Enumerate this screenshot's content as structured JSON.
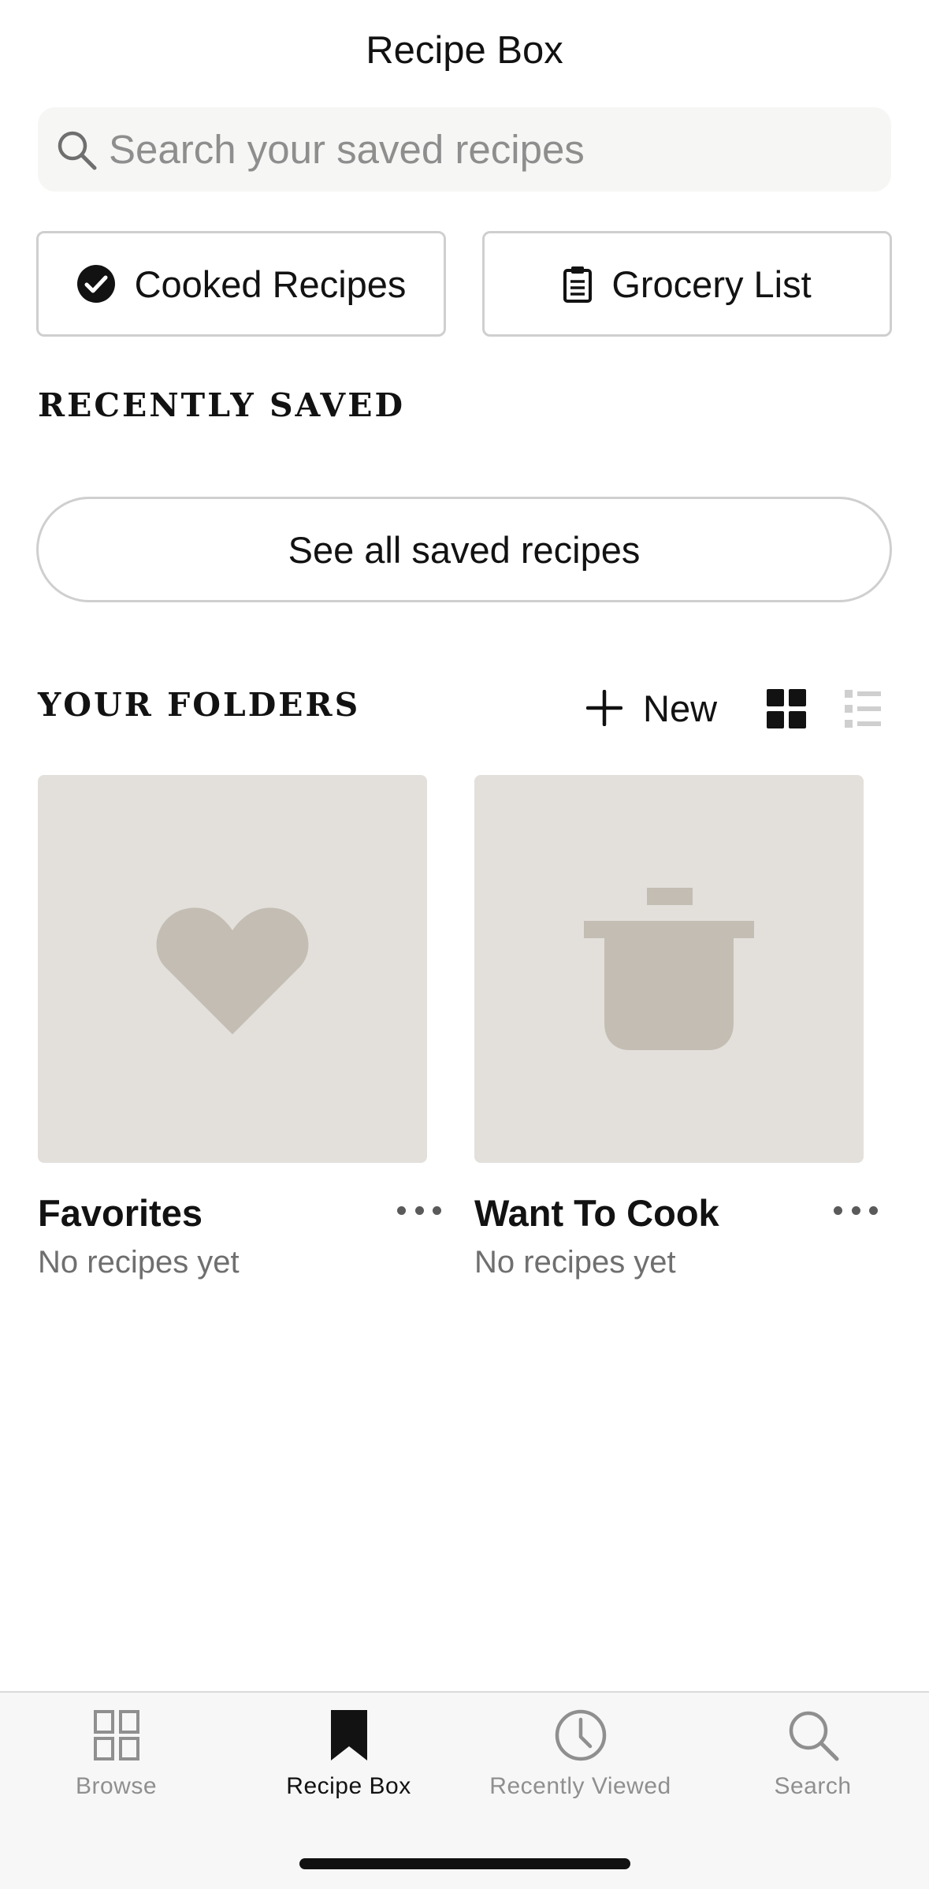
{
  "header": {
    "title": "Recipe Box"
  },
  "search": {
    "placeholder": "Search your saved recipes",
    "icon": "search-icon"
  },
  "quick_actions": {
    "cooked_label": "Cooked Recipes",
    "grocery_label": "Grocery List"
  },
  "recently_saved": {
    "heading": "RECENTLY SAVED",
    "see_all_label": "See all saved recipes"
  },
  "folders": {
    "heading": "YOUR FOLDERS",
    "new_label": "New",
    "view_mode": "grid",
    "items": [
      {
        "name": "Favorites",
        "count": "No recipes yet",
        "icon": "heart-icon"
      },
      {
        "name": "Want To Cook",
        "count": "No recipes yet",
        "icon": "pot-icon"
      }
    ]
  },
  "tabbar": {
    "active": "Recipe Box",
    "items": [
      {
        "label": "Browse",
        "icon": "grid-icon"
      },
      {
        "label": "Recipe Box",
        "icon": "bookmark-icon"
      },
      {
        "label": "Recently Viewed",
        "icon": "clock-icon"
      },
      {
        "label": "Search",
        "icon": "search-icon"
      }
    ]
  },
  "colors": {
    "text": "#121212",
    "muted": "#8e8e8e",
    "placeholder_tile": "#e3e0dc",
    "placeholder_icon": "#c4bdb3",
    "border": "#cfcfcf"
  }
}
